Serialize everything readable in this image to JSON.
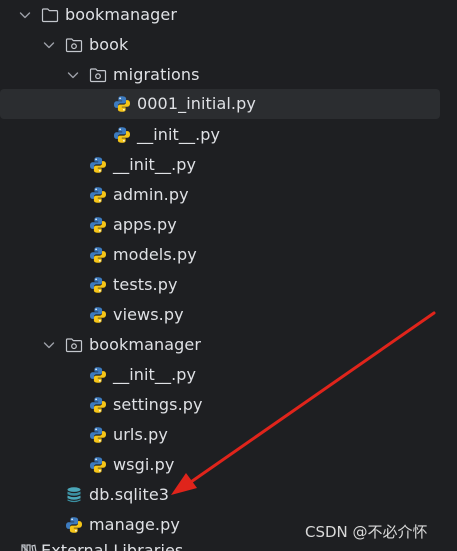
{
  "tree": {
    "items": [
      {
        "label": "bookmanager"
      },
      {
        "label": "book"
      },
      {
        "label": "migrations"
      },
      {
        "label": "0001_initial.py"
      },
      {
        "label": "__init__.py"
      },
      {
        "label": "__init__.py"
      },
      {
        "label": "admin.py"
      },
      {
        "label": "apps.py"
      },
      {
        "label": "models.py"
      },
      {
        "label": "tests.py"
      },
      {
        "label": "views.py"
      },
      {
        "label": "bookmanager"
      },
      {
        "label": "__init__.py"
      },
      {
        "label": "settings.py"
      },
      {
        "label": "urls.py"
      },
      {
        "label": "wsgi.py"
      },
      {
        "label": "db.sqlite3"
      },
      {
        "label": "manage.py"
      },
      {
        "label": "External Libraries"
      }
    ]
  },
  "watermark": "CSDN @不必介怀",
  "colors": {
    "background": "#1e1f22",
    "selection": "#2b2d30",
    "text": "#dfe1e5",
    "chevron": "#9da0a8",
    "arrow": "#e0241b",
    "python_blue": "#3d7bbf",
    "python_yellow": "#f5c518",
    "db_teal": "#4aa6b8"
  }
}
